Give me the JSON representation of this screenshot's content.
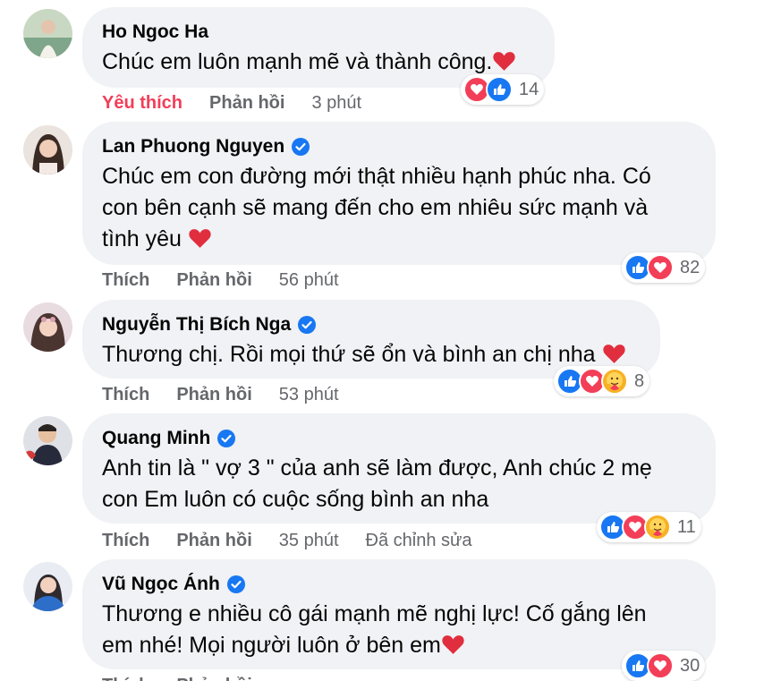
{
  "comments": [
    {
      "author": "Ho Ngoc Ha",
      "verified": false,
      "text_lines": [
        "Chúc em luôn mạnh mẽ và thành công."
      ],
      "like_label": "Yêu thích",
      "liked": true,
      "reply_label": "Phản hồi",
      "time": "3 phút",
      "edited": "",
      "reaction_icons": [
        "heart-reaction",
        "like-reaction"
      ],
      "reaction_count": "14"
    },
    {
      "author": "Lan Phuong Nguyen",
      "verified": true,
      "text_lines": [
        "Chúc em con đường mới thật nhiều hạnh phúc nha. Có",
        "con bên cạnh sẽ mang đến cho em nhiêu sức mạnh và",
        "tình yêu"
      ],
      "like_label": "Thích",
      "liked": false,
      "reply_label": "Phản hồi",
      "time": "56 phút",
      "edited": "",
      "reaction_icons": [
        "like-reaction",
        "heart-reaction"
      ],
      "reaction_count": "82"
    },
    {
      "author": "Nguyễn Thị Bích Nga",
      "verified": true,
      "text_lines": [
        "Thương chị. Rồi mọi thứ sẽ ổn và bình an chị nha"
      ],
      "like_label": "Thích",
      "liked": false,
      "reply_label": "Phản hồi",
      "time": "53 phút",
      "edited": "",
      "reaction_icons": [
        "like-reaction",
        "heart-reaction",
        "care-reaction"
      ],
      "reaction_count": "8"
    },
    {
      "author": "Quang Minh",
      "verified": true,
      "text_lines": [
        "Anh tin là \" vợ 3 \" của anh sẽ làm được, Anh chúc 2 mẹ",
        "con Em luôn có cuộc sống bình an nha"
      ],
      "like_label": "Thích",
      "liked": false,
      "reply_label": "Phản hồi",
      "time": "35 phút",
      "edited": "Đã chỉnh sửa",
      "reaction_icons": [
        "like-reaction",
        "heart-reaction",
        "care-reaction"
      ],
      "reaction_count": "11"
    },
    {
      "author": "Vũ Ngọc Ánh",
      "verified": true,
      "text_lines": [
        "Thương e nhiều cô gái mạnh mẽ nghị lực! Cố gắng lên",
        "em nhé! Mọi người luôn ở bên em"
      ],
      "like_label": "Thích",
      "liked": false,
      "reply_label": "Phản hồi",
      "time": "",
      "edited": "",
      "reaction_icons": [
        "like-reaction",
        "heart-reaction"
      ],
      "reaction_count": "30"
    }
  ],
  "colors": {
    "bubble": "#f0f2f5",
    "meta_text": "#65676b",
    "liked": "#f33e58",
    "like_blue": "#1877f2",
    "heart_red": "#f33e58",
    "verified_blue": "#1877f2"
  }
}
